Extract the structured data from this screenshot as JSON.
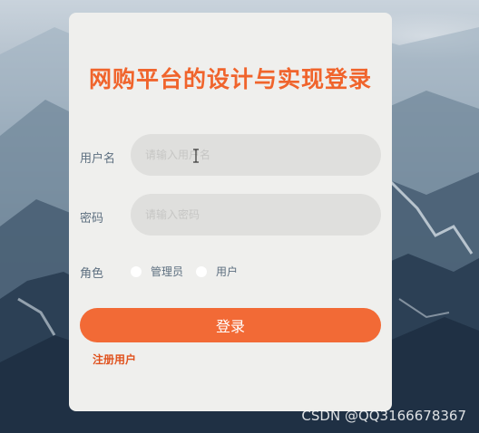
{
  "login": {
    "title": "网购平台的设计与实现登录",
    "username_label": "用户名",
    "username_placeholder": "请输入用户名",
    "password_label": "密码",
    "password_placeholder": "请输入密码",
    "role_label": "角色",
    "roles": [
      "管理员",
      "用户"
    ],
    "submit_label": "登录",
    "register_label": "注册用户"
  },
  "watermark": "CSDN @QQ3166678367",
  "colors": {
    "accent": "#f26a36",
    "title": "#f0642c",
    "card": "#efefed",
    "input": "#dfdfdd"
  }
}
